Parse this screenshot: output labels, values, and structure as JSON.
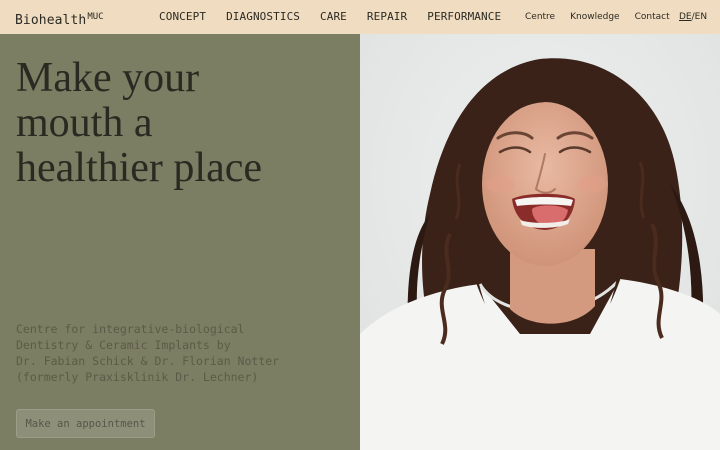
{
  "header": {
    "logo": {
      "main": "Biohealth",
      "sup": "MUC"
    },
    "nav_main": [
      "CONCEPT",
      "DIAGNOSTICS",
      "CARE",
      "REPAIR",
      "PERFORMANCE"
    ],
    "nav_secondary": [
      "Centre",
      "Knowledge",
      "Contact"
    ],
    "lang": {
      "de": "DE",
      "sep": "/",
      "en": "EN"
    }
  },
  "hero": {
    "headline": [
      "Make your",
      "mouth a",
      "healthier place"
    ],
    "intro": [
      "Centre for integrative-biological",
      "Dentistry & Ceramic Implants by",
      "Dr. Fabian Schick & Dr. Florian Notter",
      "(formerly Praxisklinik Dr. Lechner)"
    ],
    "cta_label": "Make an appointment"
  },
  "colors": {
    "header_bg": "#f0dcc0",
    "panel_bg": "#7c7e63",
    "text_dark": "#2a2a22",
    "photo_bg": "#e7e9e8"
  }
}
